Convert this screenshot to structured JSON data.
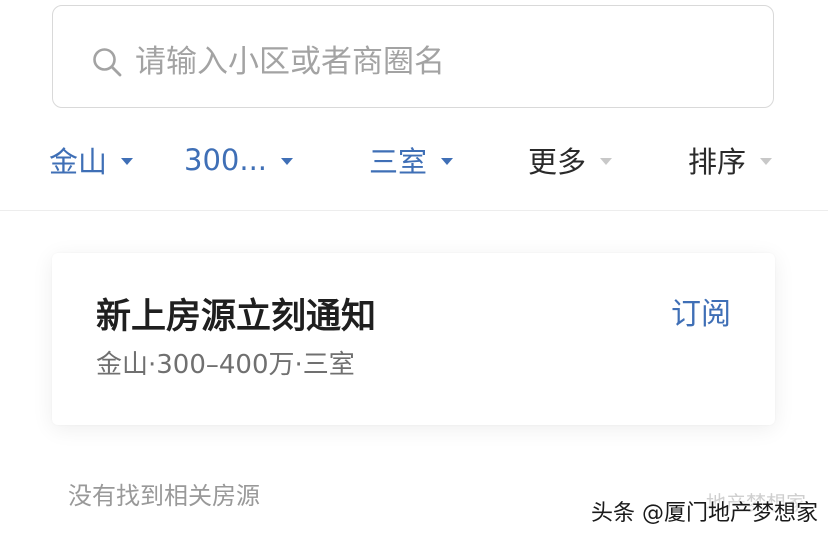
{
  "search": {
    "placeholder": "请输入小区或者商圈名",
    "icon": "search-icon"
  },
  "filters": [
    {
      "label": "金山",
      "active": true
    },
    {
      "label": "300...",
      "active": true
    },
    {
      "label": "三室",
      "active": true
    },
    {
      "label": "更多",
      "active": false
    },
    {
      "label": "排序",
      "active": false
    }
  ],
  "notify_card": {
    "title": "新上房源立刻通知",
    "subtitle": "金山·300–400万·三室",
    "subscribe_label": "订阅"
  },
  "empty_state": {
    "text": "没有找到相关房源"
  },
  "watermark": {
    "text": "头条 @厦门地产梦想家",
    "faint_text": "地产梦想家"
  },
  "colors": {
    "accent": "#3f6fb6",
    "text_dark": "#2a2a2a",
    "placeholder": "#a3a3a3",
    "muted": "#999999"
  }
}
